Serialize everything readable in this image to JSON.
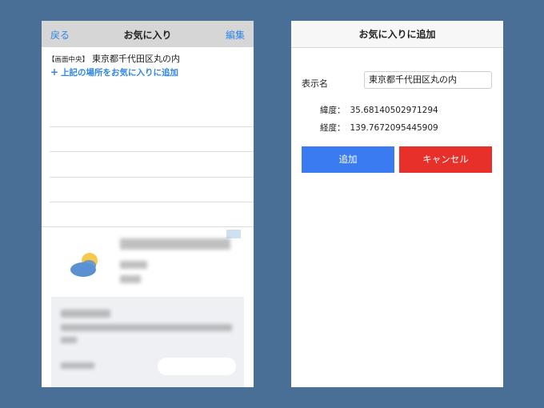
{
  "left_screen": {
    "nav": {
      "back_label": "戻る",
      "title": "お気に入り",
      "edit_label": "編集"
    },
    "center_location": {
      "tag": "【画面中央】",
      "address": "東京都千代田区丸の内"
    },
    "add_favorite_link": {
      "icon": "+",
      "label": "上記の場所をお気に入りに追加"
    },
    "advertisement": {
      "icon": "weather-icon",
      "state": "blurred"
    }
  },
  "right_screen": {
    "header": {
      "title": "お気に入りに追加"
    },
    "display_name": {
      "label": "表示名",
      "value": "東京都千代田区丸の内"
    },
    "latitude": {
      "label": "緯度：",
      "value": "35.68140502971294"
    },
    "longitude": {
      "label": "経度：",
      "value": "139.7672095445909"
    },
    "buttons": {
      "add_label": "追加",
      "cancel_label": "キャンセル"
    }
  },
  "colors": {
    "background": "#4a6f96",
    "link_blue": "#2f86e8",
    "add_button": "#3a7bf1",
    "cancel_button": "#e8302b",
    "nav_gray": "#d6d6d6"
  }
}
